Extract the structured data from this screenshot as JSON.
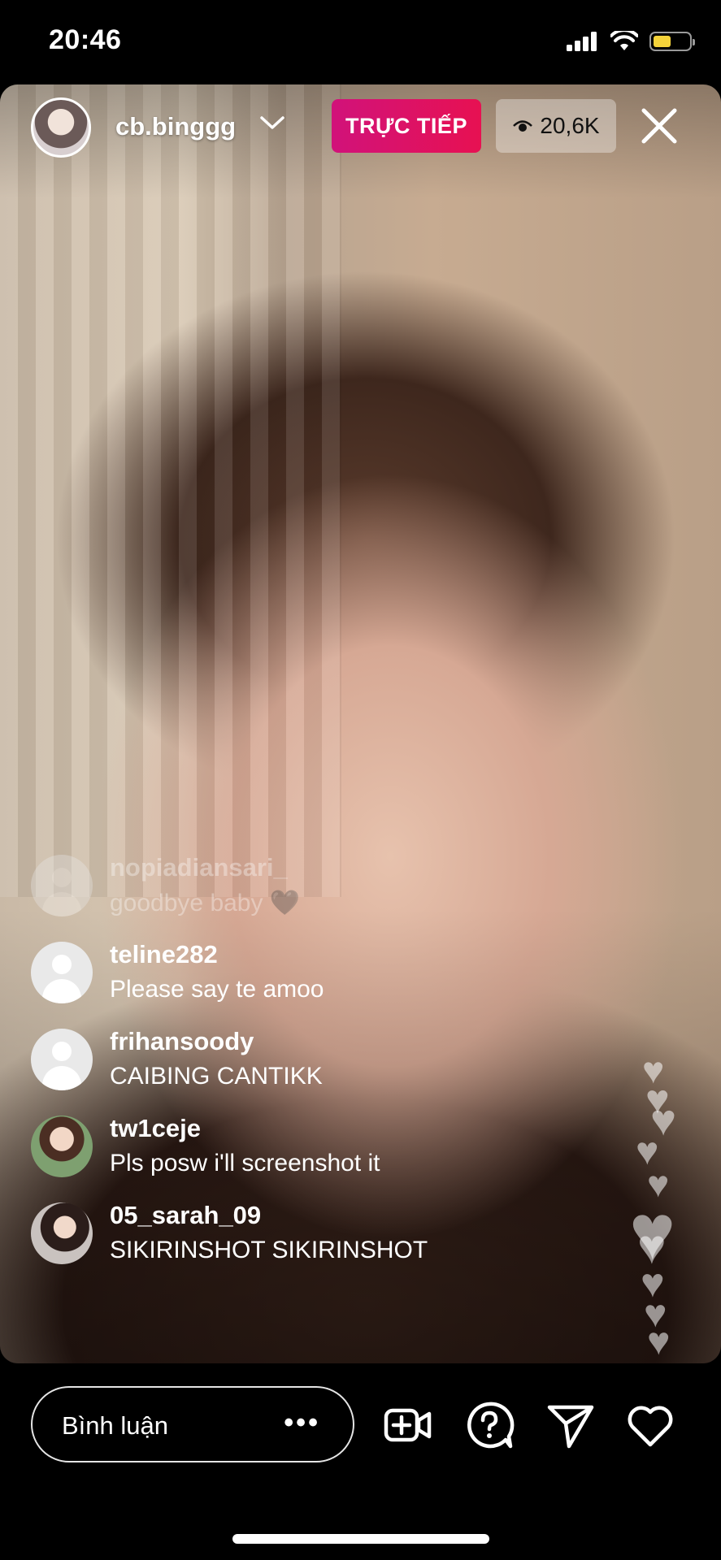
{
  "status_bar": {
    "time": "20:46",
    "signal_icon": "cellular-signal-icon",
    "wifi_icon": "wifi-icon",
    "battery_icon": "battery-icon",
    "battery_level": 0.5,
    "battery_color": "#f5d33a"
  },
  "live": {
    "host_username": "cb.binggg",
    "live_label": "TRỰC TIẾP",
    "viewer_count": "20,6K",
    "live_color": "#e0115f"
  },
  "comments": [
    {
      "username": "nopiadiansari_",
      "text": "goodbye baby 🖤"
    },
    {
      "username": "teline282",
      "text": "Please say te amoo"
    },
    {
      "username": "frihansoody",
      "text": "CAIBING CANTIKK"
    },
    {
      "username": "tw1ceje",
      "text": "Pls posw i'll screenshot it"
    },
    {
      "username": "05_sarah_09",
      "text": "SIKIRINSHOT SIKIRINSHOT"
    }
  ],
  "bottom_bar": {
    "comment_placeholder": "Bình luận",
    "more_label": "•••",
    "icons": [
      "add-video-icon",
      "question-icon",
      "send-icon",
      "heart-icon"
    ]
  }
}
